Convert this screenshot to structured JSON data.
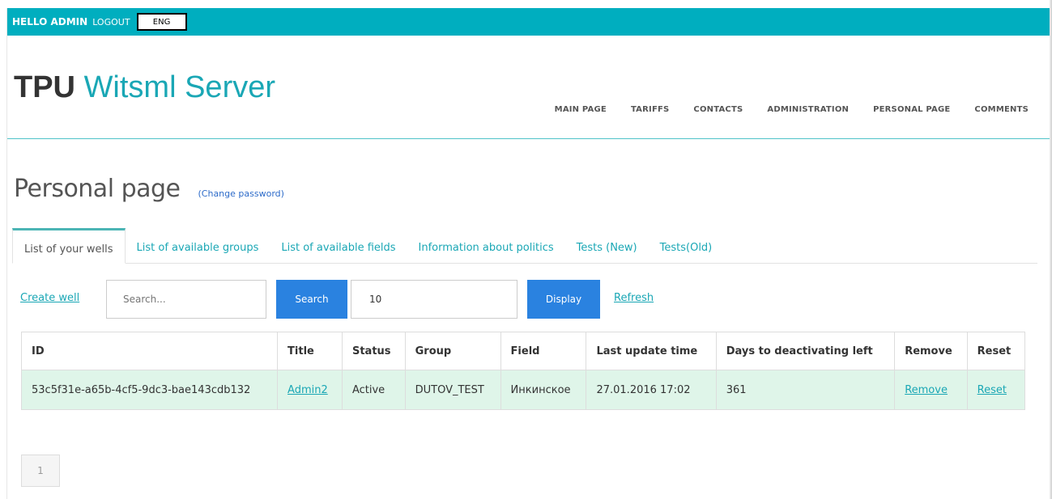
{
  "topbar": {
    "greeting": "HELLO ADMIN",
    "logout": "LOGOUT",
    "language": "ENG"
  },
  "brand": {
    "part1": "TPU",
    "part2": "Witsml Server"
  },
  "nav": [
    "MAIN PAGE",
    "TARIFFS",
    "CONTACTS",
    "ADMINISTRATION",
    "PERSONAL PAGE",
    "COMMENTS"
  ],
  "page": {
    "title": "Personal page",
    "change_password": "(Change password)"
  },
  "tabs": [
    {
      "label": "List of your wells",
      "active": true
    },
    {
      "label": "List of available groups"
    },
    {
      "label": "List of available fields"
    },
    {
      "label": "Information about politics"
    },
    {
      "label": "Tests (New)"
    },
    {
      "label": "Tests(Old)"
    }
  ],
  "toolbar": {
    "create_well": "Create well",
    "search_placeholder": "Search...",
    "search_button": "Search",
    "display_count": "10",
    "display_button": "Display",
    "refresh": "Refresh"
  },
  "table": {
    "headers": [
      "ID",
      "Title",
      "Status",
      "Group",
      "Field",
      "Last update time",
      "Days to deactivating left",
      "Remove",
      "Reset"
    ],
    "rows": [
      [
        "53c5f31e-a65b-4cf5-9dc3-bae143cdb132",
        "Admin2",
        "Active",
        "DUTOV_TEST",
        "Инкинское",
        "27.01.2016 17:02",
        "361",
        "Remove",
        "Reset"
      ]
    ]
  },
  "pagination": {
    "current": "1"
  },
  "colors": {
    "accent": "#00aebf",
    "button": "#2a82e0",
    "row_highlight": "#dff5e9"
  }
}
